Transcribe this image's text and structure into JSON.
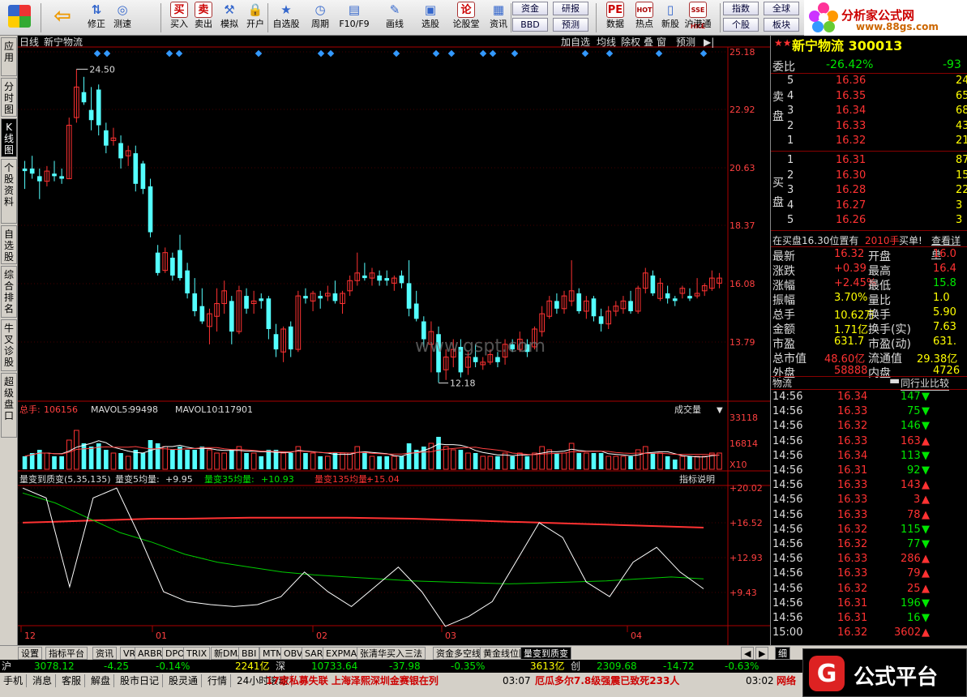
{
  "toolbar": {
    "buttons": [
      {
        "label": "修正",
        "icon": "up-down-arrows-icon"
      },
      {
        "label": "测速",
        "icon": "speed-icon"
      },
      {
        "label": "买入",
        "icon": "buy-icon",
        "glyph": "买"
      },
      {
        "label": "卖出",
        "icon": "sell-icon",
        "glyph": "卖"
      },
      {
        "label": "模拟",
        "icon": "hammer-icon"
      },
      {
        "label": "开户",
        "icon": "lock-icon"
      },
      {
        "label": "自选股",
        "icon": "star-icon"
      },
      {
        "label": "周期",
        "icon": "period-icon"
      },
      {
        "label": "F10/F9",
        "icon": "f10-icon"
      },
      {
        "label": "画线",
        "icon": "pencil-icon"
      },
      {
        "label": "选股",
        "icon": "screen-icon"
      },
      {
        "label": "论股堂",
        "icon": "forum-icon",
        "glyph": "论"
      },
      {
        "label": "资讯",
        "icon": "news-icon"
      },
      {
        "label": "数据",
        "icon": "data-icon",
        "glyph": "PE"
      },
      {
        "label": "热点",
        "icon": "hot-icon",
        "glyph": "HOT"
      },
      {
        "label": "新股",
        "icon": "new-stock-icon"
      },
      {
        "label": "沪港通",
        "icon": "shhk-icon",
        "glyph": "SSE HKE"
      }
    ],
    "mini": [
      "资金",
      "研报",
      "BBD",
      "预测",
      "指数",
      "全球",
      "个股",
      "板块"
    ]
  },
  "logo": {
    "title": "分析家公式网",
    "url": "www.88gs.com"
  },
  "left_tabs": [
    "应用",
    "分时图",
    "K线图",
    "个股资料",
    "自选股",
    "综合排名",
    "牛叉诊股",
    "超级盘口"
  ],
  "chart": {
    "header": {
      "period": "日线",
      "stock": "新宁物流"
    },
    "header_buttons": [
      "加自选",
      "均线",
      "除权",
      "叠",
      "窗",
      "预测"
    ],
    "price_axis": [
      "25.18",
      "22.92",
      "20.63",
      "18.37",
      "16.08",
      "13.79"
    ],
    "max_label": "24.50",
    "min_label": "12.18",
    "vol": {
      "label": "总手:",
      "value": "106156",
      "ma5_label": "MAVOL5:",
      "ma5": "99498",
      "ma10_label": "MAVOL10:",
      "ma10": "117901",
      "ticks": [
        "33118",
        "16814"
      ],
      "unit": "X10",
      "dropdown": "成交量"
    },
    "ind": {
      "name": "量变到质变(5,35,135)",
      "l1_label": "量变5均量:",
      "l1": "+9.95",
      "l2_label": "量变35均量:",
      "l2": "+10.93",
      "l3_label": "量变135均量:",
      "l3": "+15.04",
      "btn": "指标说明",
      "ticks": [
        "+20.02",
        "+16.52",
        "+12.93",
        "+9.43"
      ]
    },
    "x_labels": [
      "12",
      "01",
      "02",
      "03",
      "04"
    ],
    "watermark": "www.gspt.com"
  },
  "quote": {
    "title": "新宁物流 300013",
    "weibi_label": "委比",
    "weibi": "-26.42%",
    "weicha": "-93",
    "sell_label": "卖盘",
    "buy_label": "买盘",
    "sells": [
      [
        "5",
        "16.36",
        "24"
      ],
      [
        "4",
        "16.35",
        "65"
      ],
      [
        "3",
        "16.34",
        "68"
      ],
      [
        "2",
        "16.33",
        "43"
      ],
      [
        "1",
        "16.32",
        "21"
      ]
    ],
    "buys": [
      [
        "1",
        "16.31",
        "87"
      ],
      [
        "2",
        "16.30",
        "15"
      ],
      [
        "3",
        "16.28",
        "22"
      ],
      [
        "4",
        "16.27",
        "3"
      ],
      [
        "5",
        "16.26",
        "3"
      ]
    ],
    "msg1": "在买盘16.30位置有",
    "msg2": "2010手",
    "msg3": "买单!",
    "msg4": "查看详单",
    "stats": [
      [
        "最新",
        "16.32",
        "开盘",
        "16.0"
      ],
      [
        "涨跌",
        "+0.39",
        "最高",
        "16.4"
      ],
      [
        "涨幅",
        "+2.45%",
        "最低",
        "15.8"
      ],
      [
        "振幅",
        "3.70%",
        "量比",
        "1.0"
      ],
      [
        "总手",
        "10.62万",
        "换手",
        "5.90"
      ],
      [
        "金额",
        "1.71亿",
        "换手(实)",
        "7.63"
      ],
      [
        "市盈",
        "631.7",
        "市盈(动)",
        "631."
      ],
      [
        "总市值",
        "48.60亿",
        "流通值",
        "29.38亿"
      ],
      [
        "外盘",
        "58888",
        "内盘",
        "4726"
      ]
    ],
    "section_a": "物流",
    "section_b": "同行业比较",
    "ticks": [
      [
        "14:56",
        "16.34",
        "147",
        "down"
      ],
      [
        "14:56",
        "16.33",
        "75",
        "down"
      ],
      [
        "14:56",
        "16.32",
        "146",
        "down"
      ],
      [
        "14:56",
        "16.33",
        "163",
        "up"
      ],
      [
        "14:56",
        "16.34",
        "113",
        "down"
      ],
      [
        "14:56",
        "16.31",
        "92",
        "down"
      ],
      [
        "14:56",
        "16.33",
        "143",
        "up"
      ],
      [
        "14:56",
        "16.33",
        "3",
        "up"
      ],
      [
        "14:56",
        "16.33",
        "78",
        "up"
      ],
      [
        "14:56",
        "16.32",
        "115",
        "down"
      ],
      [
        "14:56",
        "16.32",
        "77",
        "down"
      ],
      [
        "14:56",
        "16.33",
        "286",
        "up"
      ],
      [
        "14:56",
        "16.33",
        "79",
        "up"
      ],
      [
        "14:56",
        "16.32",
        "25",
        "up"
      ],
      [
        "14:56",
        "16.31",
        "196",
        "down"
      ],
      [
        "14:56",
        "16.31",
        "16",
        "down"
      ],
      [
        "15:00",
        "16.32",
        "3602",
        "up"
      ]
    ]
  },
  "bottom_tabs": [
    "设置",
    "指标平台",
    "资讯",
    "VR",
    "ARBR",
    "DPO",
    "TRIX",
    "新DMA",
    "BBI",
    "MTM",
    "OBV",
    "SAR",
    "EXPMA",
    "张清华买入三法",
    "资金多空线K线",
    "黄金线位图A",
    "量变到质变"
  ],
  "detail_tab": "细",
  "status": {
    "sh": "沪",
    "sh_idx": "3078.12",
    "sh_chg": "-4.25",
    "sh_pct": "-0.14%",
    "sh_amt": "2241亿",
    "sz": "深",
    "sz_idx": "10733.64",
    "sz_chg": "-37.98",
    "sz_pct": "-0.35%",
    "sz_amt": "3613亿",
    "cy": "创",
    "cy_idx": "2309.68",
    "cy_chg": "-14.72",
    "cy_pct": "-0.63%"
  },
  "news": {
    "items": [
      "手机",
      "消息",
      "客服",
      "解盘",
      "股市日记",
      "股灵通",
      "行情",
      "24小时滚动"
    ],
    "ticker1": "17家私募失联 上海泽熙深圳金赛银在列",
    "t2": "03:07",
    "ticker2": "厄瓜多尔7.8级强震已致死233人",
    "t3": "03:02",
    "ticker3": "网络",
    "brand": "公式平台"
  },
  "colors": {
    "up": "#ff3232",
    "down": "#54ffff",
    "ma5": "#ffffff",
    "ma10": "#ff3232"
  }
}
